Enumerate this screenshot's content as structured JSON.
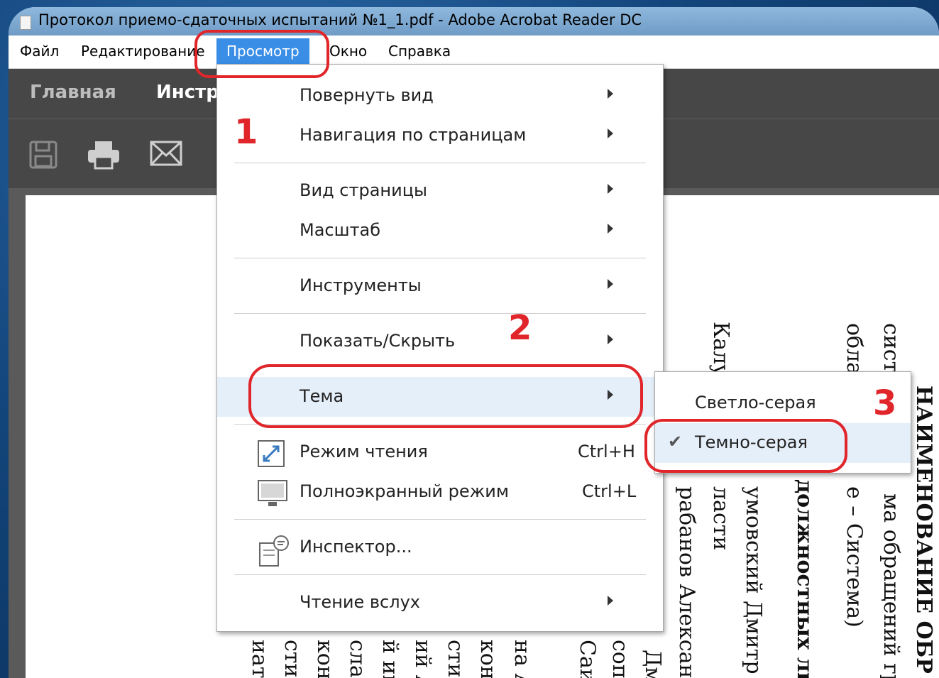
{
  "window": {
    "title": "Протокол приемо-сдаточных испытаний №1_1.pdf - Adobe Acrobat Reader DC"
  },
  "menubar": {
    "items": [
      "Файл",
      "Редактирование",
      "Просмотр",
      "Окно",
      "Справка"
    ],
    "active": "Просмотр"
  },
  "nav_tabs": [
    "Главная",
    "Инстр"
  ],
  "toolbar_icons": [
    "save-icon",
    "print-icon",
    "email-icon"
  ],
  "view_menu": {
    "items": [
      {
        "label": "Повернуть вид",
        "submenu": true
      },
      {
        "label": "Навигация по страницам",
        "submenu": true
      },
      {
        "label": "Вид страницы",
        "submenu": true
      },
      {
        "label": "Масштаб",
        "submenu": true
      },
      {
        "label": "Инструменты",
        "submenu": true
      },
      {
        "label": "Показать/Скрыть",
        "submenu": true
      },
      {
        "label": "Тема",
        "submenu": true,
        "highlighted": true
      },
      {
        "label": "Режим чтения",
        "shortcut": "Ctrl+H",
        "icon": "reading-mode-icon"
      },
      {
        "label": "Полноэкранный режим",
        "shortcut": "Ctrl+L",
        "icon": "fullscreen-icon"
      },
      {
        "label": "Инспектор...",
        "icon": "inspector-icon"
      },
      {
        "label": "Чтение вслух",
        "submenu": true
      }
    ]
  },
  "theme_submenu": {
    "items": [
      {
        "label": "Светло-серая",
        "checked": false
      },
      {
        "label": "Темно-серая",
        "checked": true
      }
    ]
  },
  "annotations": {
    "step1": "1",
    "step2": "2",
    "step3": "3",
    "color": "#e0262b"
  },
  "document_visible_text": [
    "систе",
    "облас",
    "Калу",
    "НАИМЕНОВАНИЕ ОБР",
    "ма обращений гра",
    "е – Система)",
    "должностных ли",
    "умовский Дмитр",
    "ласти",
    "рабанов Александ"
  ],
  "document_bottom_fragments": [
    "Дм",
    "соп",
    "Саид",
    "на А",
    "конт",
    "сти",
    "ий А",
    "й ин",
    "слав",
    "конт",
    "сти",
    "иато"
  ]
}
